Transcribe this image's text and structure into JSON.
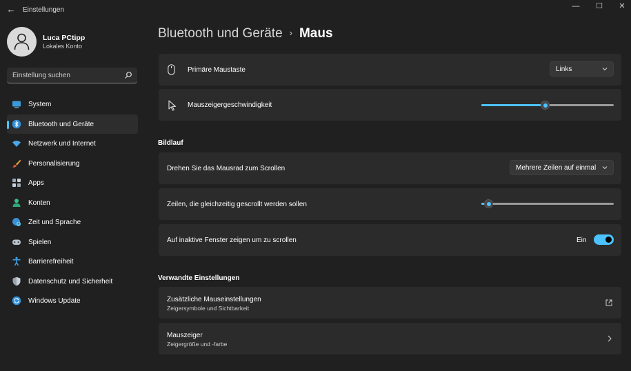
{
  "window": {
    "title": "Einstellungen",
    "controls": [
      "—",
      "☐",
      "✕"
    ]
  },
  "user": {
    "name": "Luca PCtipp",
    "account": "Lokales Konto"
  },
  "search": {
    "placeholder": "Einstellung suchen"
  },
  "nav": [
    {
      "label": "System",
      "icon": "system-icon",
      "active": false
    },
    {
      "label": "Bluetooth und Geräte",
      "icon": "bluetooth-icon",
      "active": true
    },
    {
      "label": "Netzwerk und Internet",
      "icon": "wifi-icon",
      "active": false
    },
    {
      "label": "Personalisierung",
      "icon": "brush-icon",
      "active": false
    },
    {
      "label": "Apps",
      "icon": "apps-icon",
      "active": false
    },
    {
      "label": "Konten",
      "icon": "person-icon",
      "active": false
    },
    {
      "label": "Zeit und Sprache",
      "icon": "globe-clock-icon",
      "active": false
    },
    {
      "label": "Spielen",
      "icon": "gamepad-icon",
      "active": false
    },
    {
      "label": "Barrierefreiheit",
      "icon": "accessibility-icon",
      "active": false
    },
    {
      "label": "Datenschutz und Sicherheit",
      "icon": "shield-icon",
      "active": false
    },
    {
      "label": "Windows Update",
      "icon": "update-icon",
      "active": false
    }
  ],
  "breadcrumb": {
    "parent": "Bluetooth und Geräte",
    "separator": "›",
    "current": "Maus"
  },
  "settings": {
    "primary_button": {
      "label": "Primäre Maustaste",
      "value": "Links"
    },
    "pointer_speed": {
      "label": "Mauszeigergeschwindigkeit",
      "value_fraction": 0.48
    },
    "scroll_section": "Bildlauf",
    "wheel_scroll": {
      "label": "Drehen Sie das Mausrad zum Scrollen",
      "value": "Mehrere Zeilen auf einmal"
    },
    "lines_scroll": {
      "label": "Zeilen, die gleichzeitig gescrollt werden sollen",
      "value_fraction": 0.05
    },
    "inactive_scroll": {
      "label": "Auf inaktive Fenster zeigen um zu scrollen",
      "state": "Ein"
    },
    "related_section": "Verwandte Einstellungen",
    "extra_mouse": {
      "label": "Zusätzliche Mauseinstellungen",
      "sub": "Zeigersymbole und Sichtbarkeit"
    },
    "pointer": {
      "label": "Mauszeiger",
      "sub": "Zeigergröße und -farbe"
    }
  },
  "colors": {
    "background": "#202020",
    "card": "#2b2b2b",
    "accent": "#4cc2ff"
  }
}
